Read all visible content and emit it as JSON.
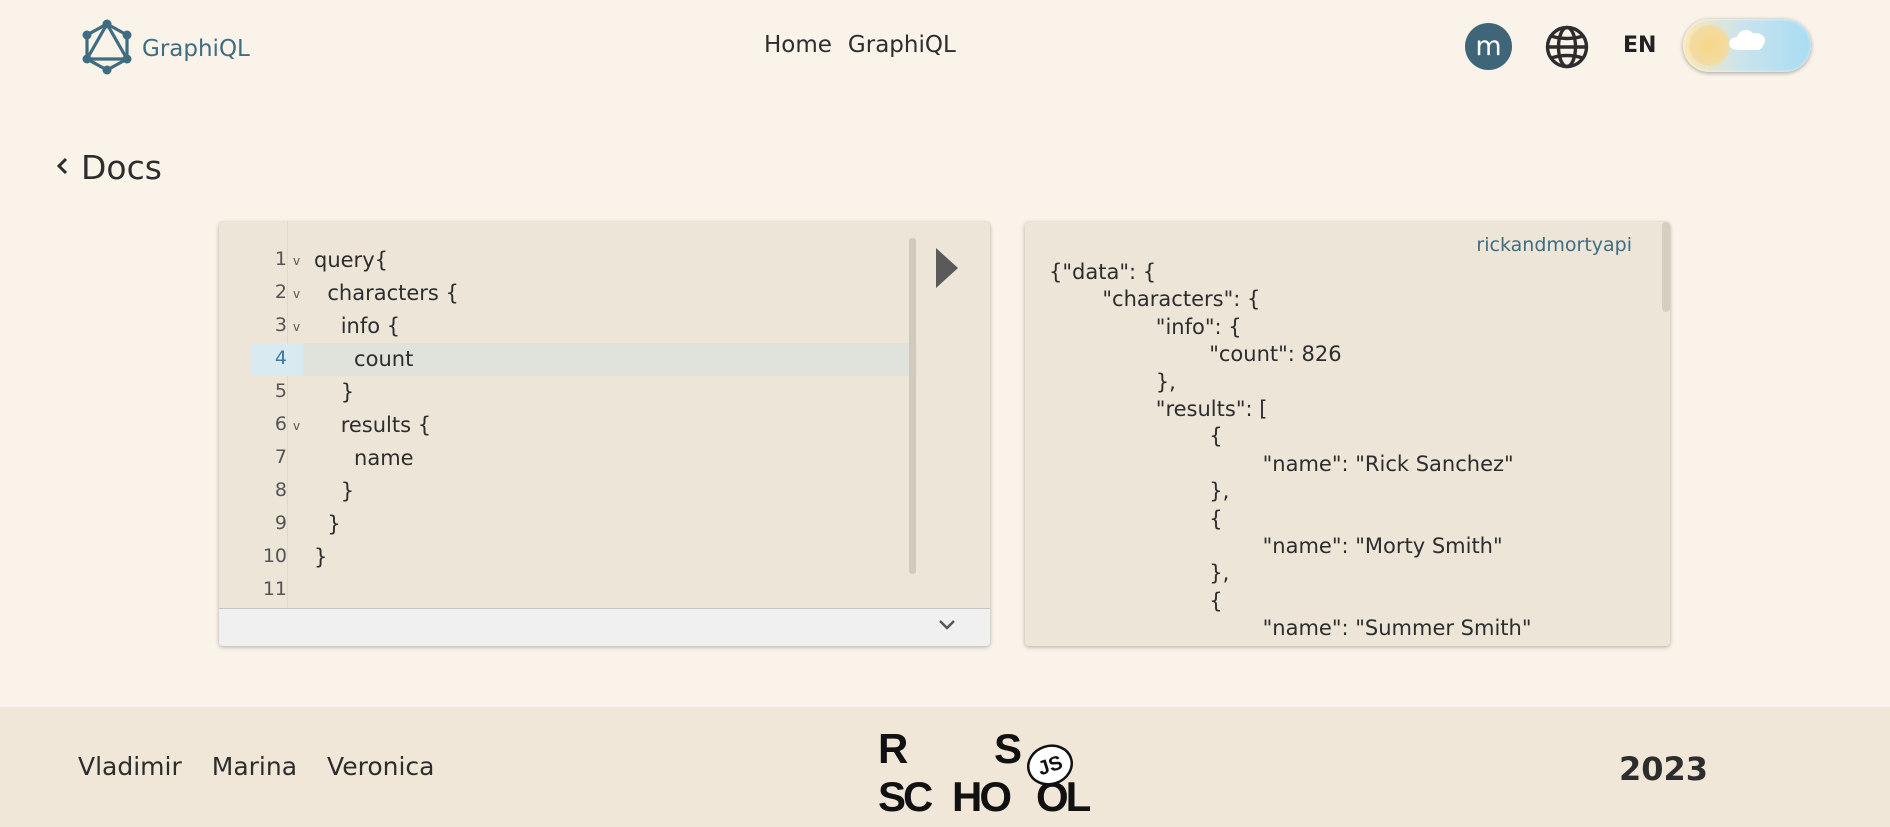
{
  "header": {
    "logo_text": "GraphiQL",
    "logo_icon": "graphql-logo-icon",
    "nav": [
      "Home",
      "GraphiQL"
    ],
    "avatar_letter": "m",
    "language": "EN",
    "theme_toggle": "sun-cloud-toggle"
  },
  "docs": {
    "label": "Docs"
  },
  "editor": {
    "lines": [
      {
        "n": "1",
        "text": "query{",
        "fold": true
      },
      {
        "n": "2",
        "text": "  characters {",
        "fold": true
      },
      {
        "n": "3",
        "text": "    info {",
        "fold": true
      },
      {
        "n": "4",
        "text": "      count",
        "fold": false,
        "active": true
      },
      {
        "n": "5",
        "text": "    }",
        "fold": false
      },
      {
        "n": "6",
        "text": "    results {",
        "fold": true
      },
      {
        "n": "7",
        "text": "      name",
        "fold": false
      },
      {
        "n": "8",
        "text": "    }",
        "fold": false
      },
      {
        "n": "9",
        "text": "  }",
        "fold": false
      },
      {
        "n": "10",
        "text": "}",
        "fold": false
      },
      {
        "n": "11",
        "text": "",
        "fold": false
      }
    ],
    "fold_marker": "v",
    "run_icon": "play-icon",
    "expand_icon": "chevron-down-icon"
  },
  "result": {
    "api_label": "rickandmortyapi",
    "lines": [
      "{\"data\": {",
      "        \"characters\": {",
      "                \"info\": {",
      "                        \"count\": 826",
      "                },",
      "                \"results\": [",
      "                        {",
      "                                \"name\": \"Rick Sanchez\"",
      "                        },",
      "                        {",
      "                                \"name\": \"Morty Smith\"",
      "                        },",
      "                        {",
      "                                \"name\": \"Summer Smith\""
    ]
  },
  "footer": {
    "authors": [
      "Vladimir",
      "Marina",
      "Veronica"
    ],
    "school_logo": {
      "top_left": "R",
      "top_right": "S",
      "badge": "JS",
      "bottom_left": "SC",
      "bottom_mid": "HO",
      "bottom_right": "OL"
    },
    "year": "2023"
  }
}
